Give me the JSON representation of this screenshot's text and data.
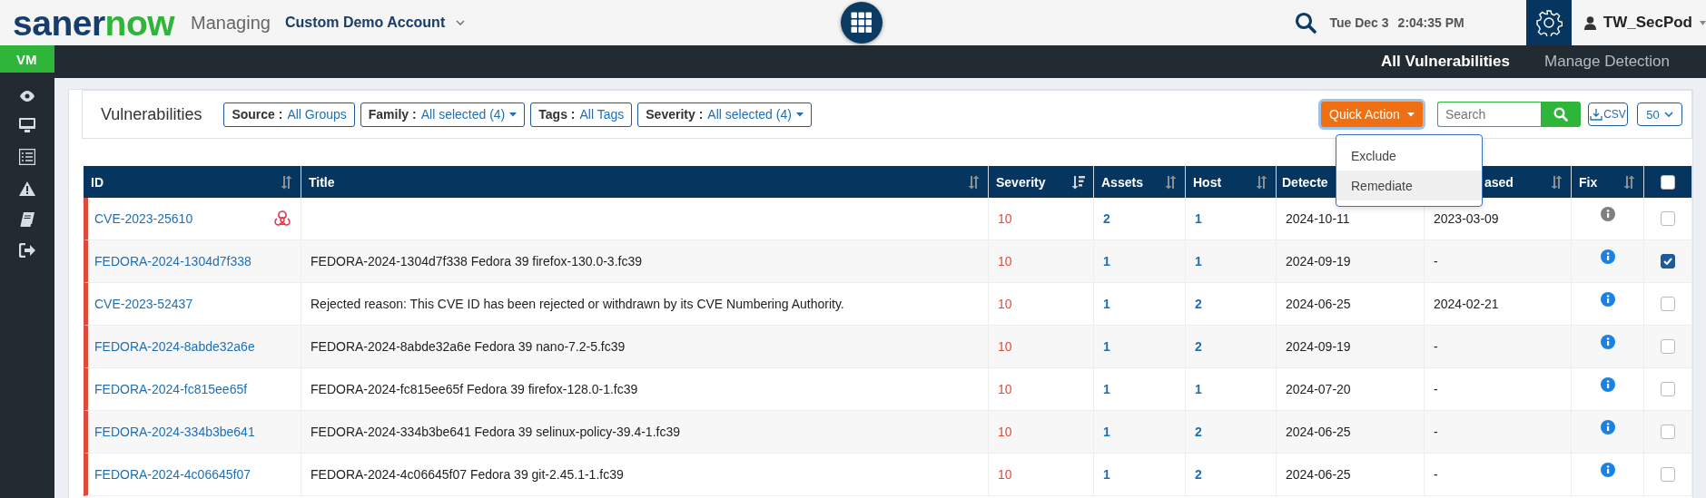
{
  "header": {
    "logo": {
      "primary": "saner",
      "accent": "now"
    },
    "managing_label": "Managing",
    "account": "Custom Demo Account",
    "date": "Tue Dec 3",
    "time": "2:04:35 PM",
    "user": "TW_SecPod"
  },
  "nav": {
    "module": "VM",
    "tabs": [
      {
        "label": "All Vulnerabilities",
        "selected": true
      },
      {
        "label": "Manage Detection",
        "selected": false
      }
    ]
  },
  "toolbar": {
    "title": "Vulnerabilities",
    "filters": [
      {
        "label": "Source :",
        "value": "All Groups",
        "dropdown": false
      },
      {
        "label": "Family :",
        "value": "All selected (4)",
        "dropdown": true
      },
      {
        "label": "Tags :",
        "value": "All Tags",
        "dropdown": false
      },
      {
        "label": "Severity :",
        "value": "All selected (4)",
        "dropdown": true
      }
    ],
    "quick_action": "Quick Action",
    "search": {
      "placeholder": "Search"
    },
    "export": "CSV",
    "page_size": "50"
  },
  "quick_action_menu": [
    {
      "label": "Exclude",
      "hovered": false
    },
    {
      "label": "Remediate",
      "hovered": true
    }
  ],
  "table": {
    "columns": [
      {
        "label": "ID",
        "sortable": true,
        "sorted": false
      },
      {
        "label": "Title",
        "sortable": true,
        "sorted": false
      },
      {
        "label": "Severity",
        "sortable": true,
        "sorted": true
      },
      {
        "label": "Assets",
        "sortable": true,
        "sorted": false
      },
      {
        "label": "Host",
        "sortable": true,
        "sorted": false
      },
      {
        "label": "Detecte"
      },
      {
        "label": "ased",
        "sortable": true,
        "sorted": false
      },
      {
        "label": "Fix",
        "sortable": true,
        "sorted": false
      },
      {
        "kind": "checkbox",
        "checked": false
      }
    ],
    "rows": [
      {
        "id": "CVE-2023-25610",
        "exploit": true,
        "severity": "10",
        "assets": "2",
        "host": "1",
        "detected": "2024-10-11",
        "released": "2023-03-09",
        "fix_available": false,
        "checked": false
      },
      {
        "id": "FEDORA-2024-1304d7f338",
        "exploit": false,
        "title": "FEDORA-2024-1304d7f338 Fedora 39 firefox-130.0-3.fc39",
        "severity": "10",
        "assets": "1",
        "host": "1",
        "detected": "2024-09-19",
        "released": "-",
        "fix_available": true,
        "checked": true
      },
      {
        "id": "CVE-2023-52437",
        "exploit": false,
        "title": "Rejected reason: This CVE ID has been rejected or withdrawn by its CVE Numbering Authority.",
        "severity": "10",
        "assets": "1",
        "host": "2",
        "detected": "2024-06-25",
        "released": "2024-02-21",
        "fix_available": true,
        "checked": false
      },
      {
        "id": "FEDORA-2024-8abde32a6e",
        "exploit": false,
        "title": "FEDORA-2024-8abde32a6e Fedora 39 nano-7.2-5.fc39",
        "severity": "10",
        "assets": "1",
        "host": "2",
        "detected": "2024-09-19",
        "released": "-",
        "fix_available": true,
        "checked": false
      },
      {
        "id": "FEDORA-2024-fc815ee65f",
        "exploit": false,
        "title": "FEDORA-2024-fc815ee65f Fedora 39 firefox-128.0-1.fc39",
        "severity": "10",
        "assets": "1",
        "host": "1",
        "detected": "2024-07-20",
        "released": "-",
        "fix_available": true,
        "checked": false
      },
      {
        "id": "FEDORA-2024-334b3be641",
        "exploit": false,
        "title": "FEDORA-2024-334b3be641 Fedora 39 selinux-policy-39.4-1.fc39",
        "severity": "10",
        "assets": "1",
        "host": "2",
        "detected": "2024-06-25",
        "released": "-",
        "fix_available": true,
        "checked": false
      },
      {
        "id": "FEDORA-2024-4c06645f07",
        "exploit": false,
        "title": "FEDORA-2024-4c06645f07 Fedora 39 git-2.45.1-1.fc39",
        "severity": "10",
        "assets": "1",
        "host": "2",
        "detected": "2024-06-25",
        "released": "-",
        "fix_available": true,
        "checked": false
      }
    ]
  }
}
